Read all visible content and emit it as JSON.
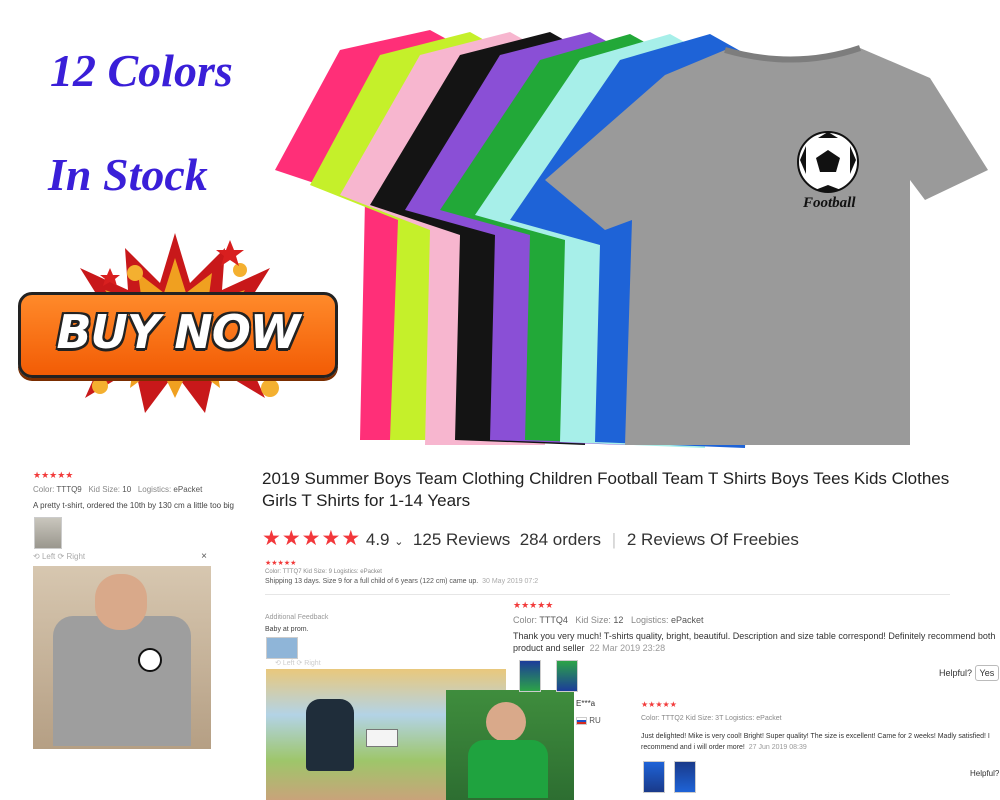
{
  "banner": {
    "colors_text": "12 Colors",
    "stock_text": "In Stock",
    "buy_label": "BUY NOW",
    "shirt_colors": [
      "#ff2f78",
      "#c5f02a",
      "#f7b6cf",
      "#141414",
      "#8a4fd6",
      "#22a838",
      "#a7efe9",
      "#1e63d7",
      "#9a9a9a"
    ],
    "print_text": "Football"
  },
  "product": {
    "title": "2019 Summer Boys Team Clothing Children Football Team T Shirts Boys Tees Kids Clothes Girls T Shirts for 1-14 Years",
    "rating": "4.9",
    "reviews": "125 Reviews",
    "orders": "284 orders",
    "freebies": "2 Reviews Of Freebies"
  },
  "review_left": {
    "stars": "★★★★★",
    "color_label": "Color:",
    "color_value": "TTTQ9",
    "size_label": "Kid Size:",
    "size_value": "10",
    "logistics_label": "Logistics:",
    "logistics_value": "ePacket",
    "text": "A pretty t-shirt, ordered the 10th by 130 cm a little too big",
    "left": "Left",
    "right": "Right",
    "close": "×"
  },
  "review_mid_top": {
    "stars": "★★★★★",
    "meta": "Color: TTTQ7   Kid Size: 9   Logistics: ePacket",
    "text": "Shipping 13 days. Size 9 for a full child of 6 years (122 cm) came up.",
    "date": "30 May 2019 07:2"
  },
  "review_mid_add": {
    "header": "Additional Feedback",
    "text": "Baby at prom.",
    "left": "Left",
    "right": "Right"
  },
  "review_right1": {
    "stars": "★★★★★",
    "color_label": "Color:",
    "color_value": "TTTQ4",
    "size_label": "Kid Size:",
    "size_value": "12",
    "logistics_label": "Logistics:",
    "logistics_value": "ePacket",
    "text": "Thank you very much! T-shirts quality, bright, beautiful. Description and size table correspond! Definitely recommend both product and seller",
    "date": "22 Mar 2019 23:28",
    "helpful": "Helpful?",
    "yes": "Yes"
  },
  "buyer": {
    "name": "E***a",
    "country": "RU"
  },
  "review_right2": {
    "stars": "★★★★★",
    "meta": "Color: TTTQ2   Kid Size: 3T   Logistics: ePacket",
    "text": "Just delighted! Mike is very cool! Bright! Super quality! The size is excellent! Came for 2 weeks! Madly satisfied! I recommend and i will order more!",
    "date": "27 Jun 2019 08:39",
    "helpful": "Helpful?"
  }
}
